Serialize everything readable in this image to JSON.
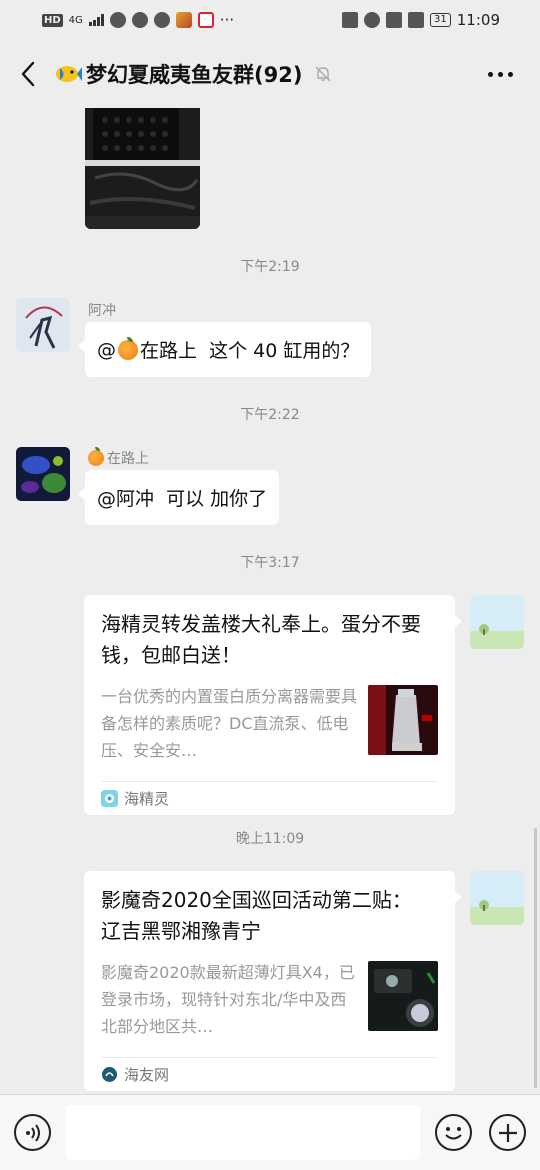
{
  "status_bar": {
    "hd": "HD",
    "network": "4G",
    "battery": "31",
    "time": "11:09",
    "more": "···"
  },
  "header": {
    "title": "梦幻夏威夷鱼友群(92)"
  },
  "messages": [
    {
      "type": "timestamp",
      "text": "下午2:19"
    },
    {
      "type": "text",
      "sender": "阿冲",
      "text_before": "@",
      "mention": "在路上",
      "text_after": "  这个 40 缸用的？"
    },
    {
      "type": "timestamp",
      "text": "下午2:22"
    },
    {
      "type": "text",
      "sender": "在路上",
      "text": "@阿冲  可以 加你了"
    },
    {
      "type": "timestamp",
      "text": "下午3:17"
    },
    {
      "type": "link_card",
      "title": "海精灵转发盖楼大礼奉上。蛋分不要钱，包邮白送！",
      "desc": "一台优秀的内置蛋白质分离器需要具备怎样的素质呢？DC直流泵、低电压、安全安…",
      "source": "海精灵"
    },
    {
      "type": "timestamp",
      "text": "晚上11:09"
    },
    {
      "type": "link_card",
      "title": "影魔奇2020全国巡回活动第二贴：  辽吉黑鄂湘豫青宁",
      "desc": "影魔奇2020款最新超薄灯具X4，已登录市场，现特针对东北/华中及西北部分地区共…",
      "source": "海友网"
    }
  ],
  "input": {
    "value": "",
    "placeholder": ""
  },
  "colors": {
    "background": "#ededed",
    "bubble": "#ffffff",
    "timestamp": "#888888",
    "card_desc": "#999999"
  }
}
